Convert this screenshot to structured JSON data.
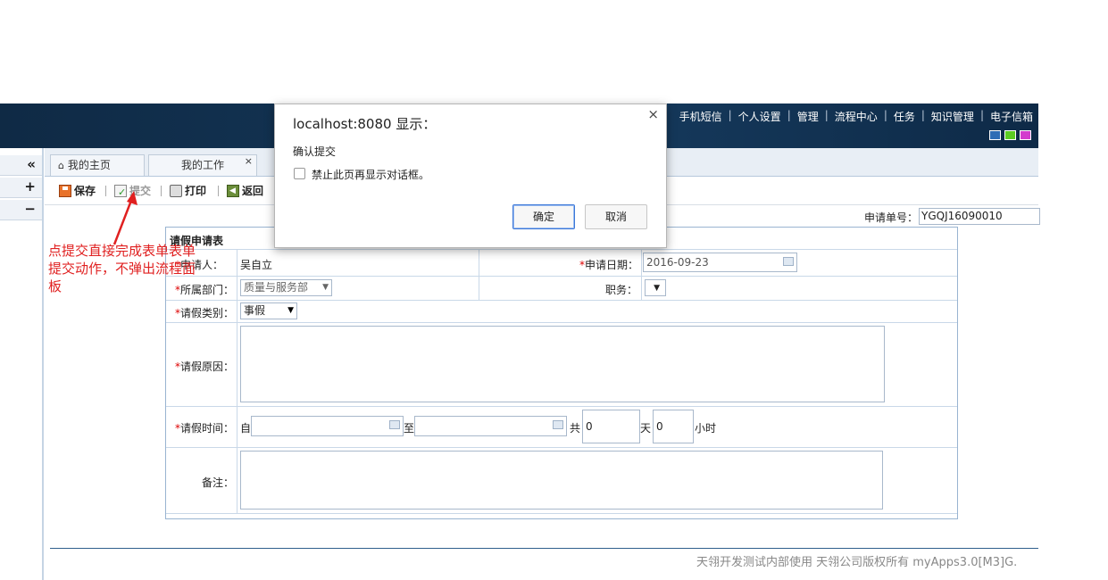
{
  "header": {
    "nav": [
      "手机短信",
      "个人设置",
      "管理",
      "流程中心",
      "任务",
      "知识管理",
      "电子信箱"
    ],
    "theme_colors": [
      "#2f6db5",
      "#5ccc22",
      "#d33bcd"
    ]
  },
  "left_panel": {
    "collapse": "«",
    "expand": "+",
    "shrink": "−"
  },
  "tabs": [
    {
      "label": "我的主页",
      "icon": "home-icon"
    },
    {
      "label": "我的工作",
      "close": "×"
    }
  ],
  "toolbar": {
    "save": "保存",
    "submit": "提交",
    "print": "打印",
    "back": "返回"
  },
  "form": {
    "apply_no_label": "申请单号：",
    "apply_no": "YGQJ16090010",
    "title": "请假申请表",
    "applicant_label": "申请人：",
    "applicant": "吴自立",
    "apply_date_label": "申请日期：",
    "apply_date": "2016-09-23",
    "dept_label": "所属部门：",
    "dept": "质量与服务部",
    "position_label": "职务：",
    "leave_type_label": "请假类别：",
    "leave_type": "事假",
    "reason_label": "请假原因：",
    "time_label": "请假时间：",
    "from": "自",
    "to": "至",
    "total": "共",
    "days": "0",
    "days_unit": "天",
    "hours": "0",
    "hours_unit": "小时",
    "note_label": "备注："
  },
  "annotation": "点提交直接完成表单表单提交动作，不弹出流程面板",
  "footer": "天翎开发测试内部使用 天翎公司版权所有 myApps3.0[M3]G.",
  "dialog": {
    "title": "localhost:8080 显示：",
    "close": "×",
    "message": "确认提交",
    "checkbox_label": "禁止此页再显示对话框。",
    "ok": "确定",
    "cancel": "取消"
  }
}
